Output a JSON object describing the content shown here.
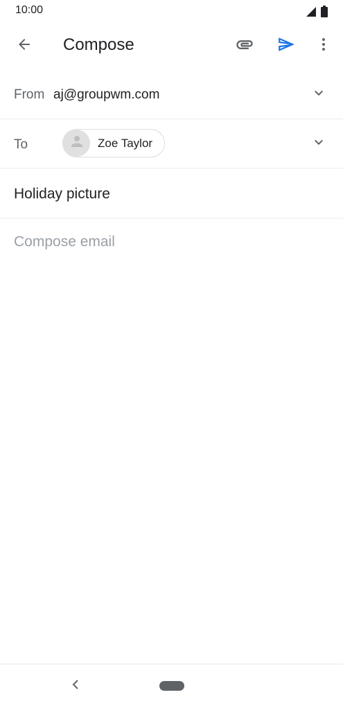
{
  "status_bar": {
    "time": "10:00",
    "icons": [
      "signal-icon",
      "battery-icon"
    ]
  },
  "app_bar": {
    "title": "Compose",
    "icons": [
      "arrow-back-icon",
      "paperclip-icon",
      "send-icon",
      "more-vert-icon"
    ]
  },
  "from": {
    "label": "From",
    "value": "aj@groupwm.com"
  },
  "to": {
    "label": "To",
    "recipient": "Zoe Taylor"
  },
  "subject": {
    "value": "Holiday picture"
  },
  "body": {
    "placeholder": "Compose email",
    "value": ""
  },
  "colors": {
    "accent": "#1a73e8",
    "text_primary": "#202124",
    "text_secondary": "#5f6368",
    "placeholder": "#9aa0a6",
    "divider": "#ececec"
  }
}
